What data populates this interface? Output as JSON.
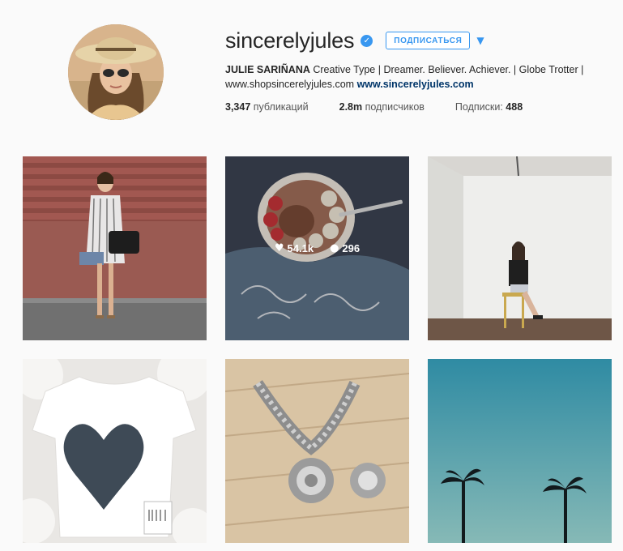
{
  "profile": {
    "username": "sincerelyjules",
    "verified_icon": "verified-check-icon",
    "follow_label": "ПОДПИСАТЬСЯ",
    "dropdown_icon": "caret-down-icon",
    "full_name": "JULIE SARIÑANA",
    "bio": "Creative Type | Dreamer. Believer. Achiever. | Globe Trotter |",
    "bio_url_plain": "www.shopsincerelyjules.com",
    "bio_url_link": "www.sincerelyjules.com",
    "stats": {
      "posts_count": "3,347",
      "posts_label": "публикаций",
      "followers_count": "2.8m",
      "followers_label": "подписчиков",
      "following_label": "Подписки:",
      "following_count": "488"
    }
  },
  "posts": [
    {
      "subject": "woman in striped dress by brick wall"
    },
    {
      "subject": "acai bowl on denim",
      "likes": "54.1k",
      "comments": "296"
    },
    {
      "subject": "woman on stool in white room"
    },
    {
      "subject": "white tee with heart print"
    },
    {
      "subject": "silver statement necklace and ring"
    },
    {
      "subject": "palm trees at dusk"
    }
  ],
  "colors": {
    "accent": "#3897f0",
    "link": "#003569",
    "background": "#fafafa"
  }
}
